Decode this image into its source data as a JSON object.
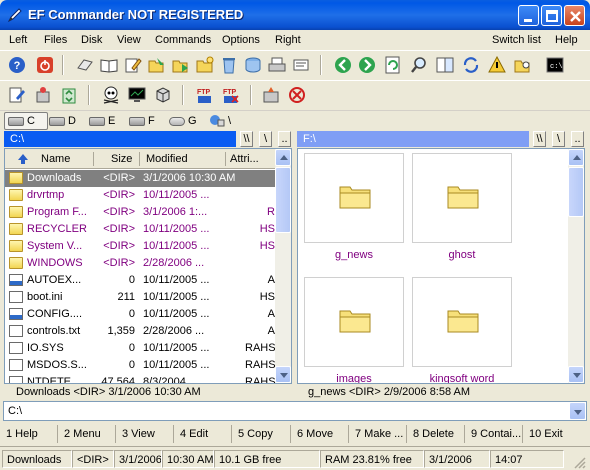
{
  "window": {
    "title": "EF Commander NOT REGISTERED"
  },
  "menu": {
    "left": "Left",
    "files": "Files",
    "disk": "Disk",
    "view": "View",
    "commands": "Commands",
    "options": "Options",
    "right": "Right",
    "switch_list": "Switch list",
    "help": "Help"
  },
  "drives": {
    "c": "C",
    "d": "D",
    "e": "E",
    "f": "F",
    "g": "G",
    "backslash": "\\"
  },
  "left_panel": {
    "path": "C:\\",
    "btn_root": "\\\\",
    "btn_back": "\\",
    "btn_up": "..",
    "columns": {
      "name": "Name",
      "size": "Size",
      "modified": "Modified",
      "attr": "Attri..."
    },
    "rows": [
      {
        "name": "Downloads",
        "size": "<DIR>",
        "date": "3/1/2006  10:30 AM",
        "attr": ""
      },
      {
        "name": "drvrtmp",
        "size": "<DIR>",
        "date": "10/11/2005 ...",
        "attr": ""
      },
      {
        "name": "Program F...",
        "size": "<DIR>",
        "date": "3/1/2006  1:...",
        "attr": "R"
      },
      {
        "name": "RECYCLER",
        "size": "<DIR>",
        "date": "10/11/2005 ...",
        "attr": "HS"
      },
      {
        "name": "System V...",
        "size": "<DIR>",
        "date": "10/11/2005 ...",
        "attr": "HS"
      },
      {
        "name": "WINDOWS",
        "size": "<DIR>",
        "date": "2/28/2006 ...",
        "attr": ""
      },
      {
        "name": "AUTOEX...",
        "size": "0",
        "date": "10/11/2005 ...",
        "attr": "A"
      },
      {
        "name": "boot.ini",
        "size": "211",
        "date": "10/11/2005 ...",
        "attr": "HS"
      },
      {
        "name": "CONFIG....",
        "size": "0",
        "date": "10/11/2005 ...",
        "attr": "A"
      },
      {
        "name": "controls.txt",
        "size": "1,359",
        "date": "2/28/2006 ...",
        "attr": "A"
      },
      {
        "name": "IO.SYS",
        "size": "0",
        "date": "10/11/2005 ...",
        "attr": "RAHS"
      },
      {
        "name": "MSDOS.S...",
        "size": "0",
        "date": "10/11/2005 ...",
        "attr": "RAHS"
      },
      {
        "name": "NTDETE...",
        "size": "47,564",
        "date": "8/3/2004 ...",
        "attr": "RAHS"
      }
    ],
    "status": "Downloads    <DIR>  3/1/2006  10:30 AM"
  },
  "right_panel": {
    "path": "F:\\",
    "btn_root": "\\\\",
    "btn_back": "\\",
    "btn_up": "..",
    "tiles": [
      "g_news",
      "ghost",
      "images",
      "kingsoft word"
    ],
    "status": "g_news    <DIR>  2/9/2006  8:58 AM"
  },
  "command_line": {
    "value": "C:\\"
  },
  "function_keys": [
    "1 Help",
    "2 Menu",
    "3 View",
    "4 Edit",
    "5 Copy",
    "6 Move",
    "7 Make ...",
    "8 Delete",
    "9 Contai...",
    "10 Exit"
  ],
  "statusbar": {
    "name": "Downloads",
    "size": "<DIR>",
    "date": "3/1/2006",
    "time": "10:30 AM",
    "free": "10.1 GB free",
    "ram": "RAM 23.81% free",
    "current_date": "3/1/2006",
    "clock": "14:07"
  },
  "colors": {
    "path_active": "#0a5cf2",
    "path_inactive": "#7f9ef5",
    "dir_text": "#800080"
  }
}
